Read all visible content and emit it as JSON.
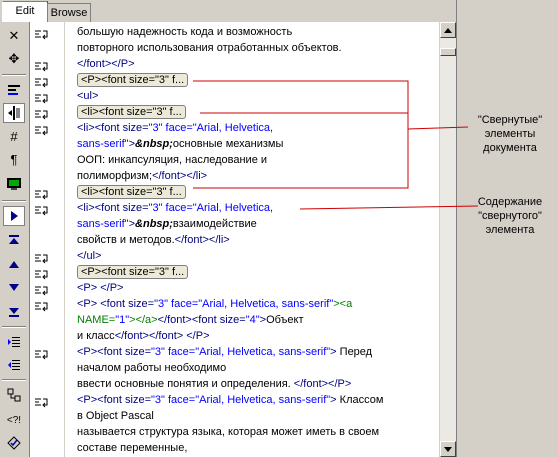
{
  "tabs": [
    {
      "label": "Edit"
    },
    {
      "label": "Browse"
    }
  ],
  "lines": [
    [
      {
        "t": "большую надежность кода и возможность"
      }
    ],
    [
      {
        "t": "  повторного использования отработанных объектов."
      }
    ],
    [
      {
        "t": "</font></P>",
        "c": "t"
      }
    ],
    [
      {
        "f": "<P><font size=\"3\" f..."
      }
    ],
    [
      {
        "t": "<ul>",
        "c": "t"
      }
    ],
    [
      {
        "t": "  "
      },
      {
        "f": "<li><font size=\"3\" f..."
      }
    ],
    [
      {
        "t": "  <li><font size=",
        "c": "t"
      },
      {
        "t": "\"3\" face=\"Arial, Helvetica,",
        "c": "v"
      }
    ],
    [
      {
        "t": "sans-serif\"",
        "c": "v"
      },
      {
        "t": ">",
        "c": "t"
      },
      {
        "t": "&nbsp;",
        "c": "nb"
      },
      {
        "t": "основные механизмы"
      }
    ],
    [
      {
        "t": "    ООП: инкапсуляция, наследование и"
      }
    ],
    [
      {
        "t": "полиморфизм;"
      },
      {
        "t": "</font></li>",
        "c": "t"
      }
    ],
    [
      {
        "t": "  "
      },
      {
        "f": "<li><font size=\"3\" f..."
      }
    ],
    [
      {
        "t": "  <li><font size=",
        "c": "t"
      },
      {
        "t": "\"3\" face=\"Arial, Helvetica,",
        "c": "v"
      }
    ],
    [
      {
        "t": "sans-serif\"",
        "c": "v"
      },
      {
        "t": ">",
        "c": "t"
      },
      {
        "t": "&nbsp;",
        "c": "nb"
      },
      {
        "t": "взаимодействие"
      }
    ],
    [
      {
        "t": "    свойств и методов."
      },
      {
        "t": "</font></li>",
        "c": "t"
      }
    ],
    [
      {
        "t": "</ul>",
        "c": "t"
      }
    ],
    [
      {
        "f": "<P><font size=\"3\" f..."
      }
    ],
    [
      {
        "t": "<P> </P>",
        "c": "t"
      }
    ],
    [
      {
        "t": "<P> <font size=",
        "c": "t"
      },
      {
        "t": "\"3\" face=\"Arial, Helvetica, sans-serif\"",
        "c": "v"
      },
      {
        "t": "><a",
        "c": "g"
      }
    ],
    [
      {
        "t": "NAME=",
        "c": "g"
      },
      {
        "t": "\"1\"",
        "c": "v"
      },
      {
        "t": "></a>",
        "c": "g"
      },
      {
        "t": "</font><font size=",
        "c": "t"
      },
      {
        "t": "\"4\"",
        "c": "v"
      },
      {
        "t": ">",
        "c": "t"
      },
      {
        "t": "Объект"
      }
    ],
    [
      {
        "t": "  и класс"
      },
      {
        "t": "</font></font> </P>",
        "c": "t"
      }
    ],
    [
      {
        "t": "<P><font size=",
        "c": "t"
      },
      {
        "t": "\"3\" face=\"Arial, Helvetica, sans-serif\"",
        "c": "v"
      },
      {
        "t": "> ",
        "c": "t"
      },
      {
        "t": "Перед"
      }
    ],
    [
      {
        "t": "началом работы необходимо"
      }
    ],
    [
      {
        "t": "  ввести основные понятия и определения. "
      },
      {
        "t": "</font></P>",
        "c": "t"
      }
    ],
    [
      {
        "t": "<P><font size=",
        "c": "t"
      },
      {
        "t": "\"3\" face=\"Arial, Helvetica, sans-serif\"",
        "c": "v"
      },
      {
        "t": "> ",
        "c": "t"
      },
      {
        "t": "Классом"
      }
    ],
    [
      {
        "t": "в Object Pascal"
      }
    ],
    [
      {
        "t": "  называется структура языка, которая может иметь в своем"
      }
    ],
    [
      {
        "t": "составе переменные,"
      }
    ]
  ],
  "annotations": {
    "collapsed": [
      "\"Свернутые\"",
      "элементы",
      "документа"
    ],
    "content": [
      "Содержание",
      "\"свернутого\"",
      "элемента"
    ]
  },
  "colors": {
    "tag": "#000080",
    "attr": "#0000ff",
    "anchor": "#008000",
    "arrow": "#cc0000"
  },
  "toolbar_icons": [
    "close-icon",
    "move-icon",
    "word-wrap-icon",
    "indent-markers-icon",
    "hash-icon",
    "paragraph-icon",
    "monitor-icon",
    "play-icon",
    "goto-top-icon",
    "up-icon",
    "down-icon",
    "goto-bottom-icon",
    "indent-icon",
    "outdent-icon",
    "link-icon",
    "tag-icon",
    "validate-icon"
  ]
}
